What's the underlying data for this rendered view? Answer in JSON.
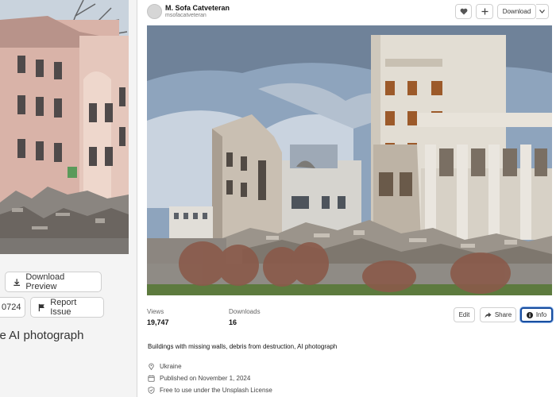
{
  "left": {
    "download_preview_label": "Download Preview",
    "id_fragment": "0724",
    "report_issue_label": "Report Issue",
    "title_fragment": "ve AI photograph"
  },
  "header": {
    "author_name": "M. Sofa Catveteran",
    "author_handle": "msofacatveteran",
    "download_label": "Download"
  },
  "stats": {
    "views_label": "Views",
    "views_value": "19,747",
    "downloads_label": "Downloads",
    "downloads_value": "16"
  },
  "actions": {
    "edit_label": "Edit",
    "share_label": "Share",
    "info_label": "Info"
  },
  "description": "Buildings with missing walls, debris from destruction, AI photograph",
  "meta": {
    "location": "Ukraine",
    "published": "Published on November 1, 2024",
    "license": "Free to use under the Unsplash License"
  },
  "colors": {
    "info_focus_ring": "#1a4fa0",
    "overlay": "#6e6e6e"
  },
  "icons": [
    "download-icon",
    "flag-icon",
    "heart-icon",
    "plus-icon",
    "chevron-down-icon",
    "share-icon",
    "info-icon",
    "location-pin-icon",
    "calendar-icon",
    "shield-check-icon"
  ]
}
